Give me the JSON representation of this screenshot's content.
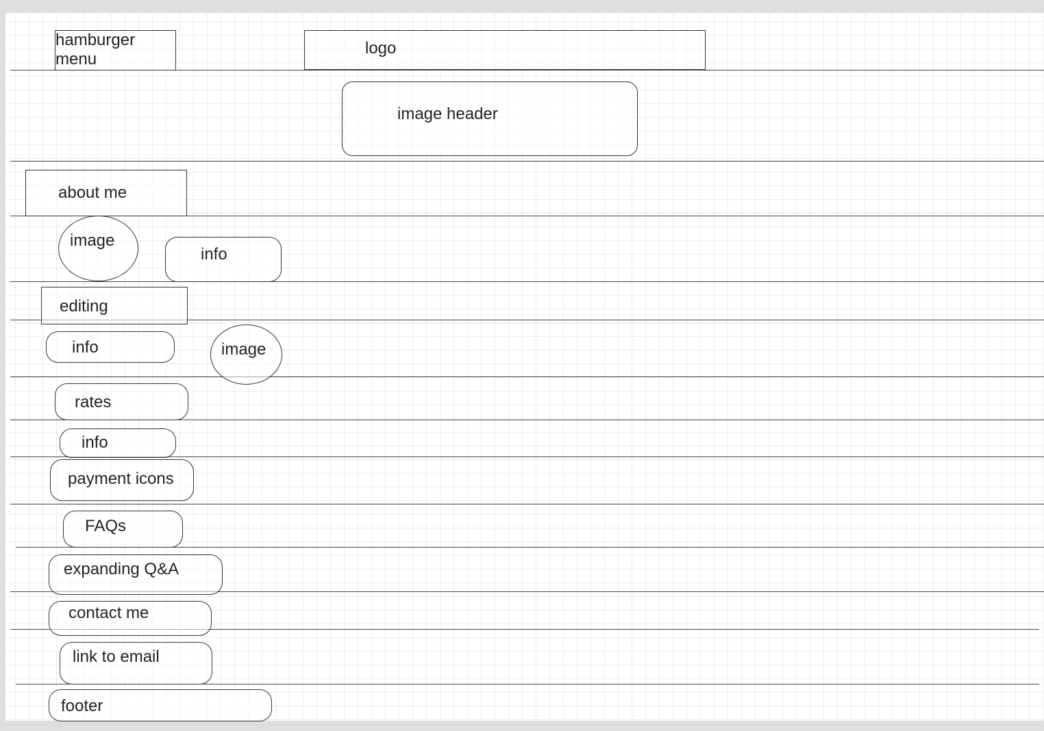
{
  "wireframe": {
    "header": {
      "hamburger_menu": "hamburger\nmenu",
      "logo": "logo",
      "image_header": "image header"
    },
    "about": {
      "title": "about me",
      "image": "image",
      "info": "info"
    },
    "editing": {
      "title": "editing",
      "info": "info",
      "image": "image"
    },
    "rates": {
      "title": "rates",
      "info": "info",
      "payment": "payment icons"
    },
    "faqs": {
      "title": "FAQs",
      "qa": "expanding Q&A"
    },
    "contact": {
      "title": "contact me",
      "email": "link to email"
    },
    "footer": "footer"
  }
}
